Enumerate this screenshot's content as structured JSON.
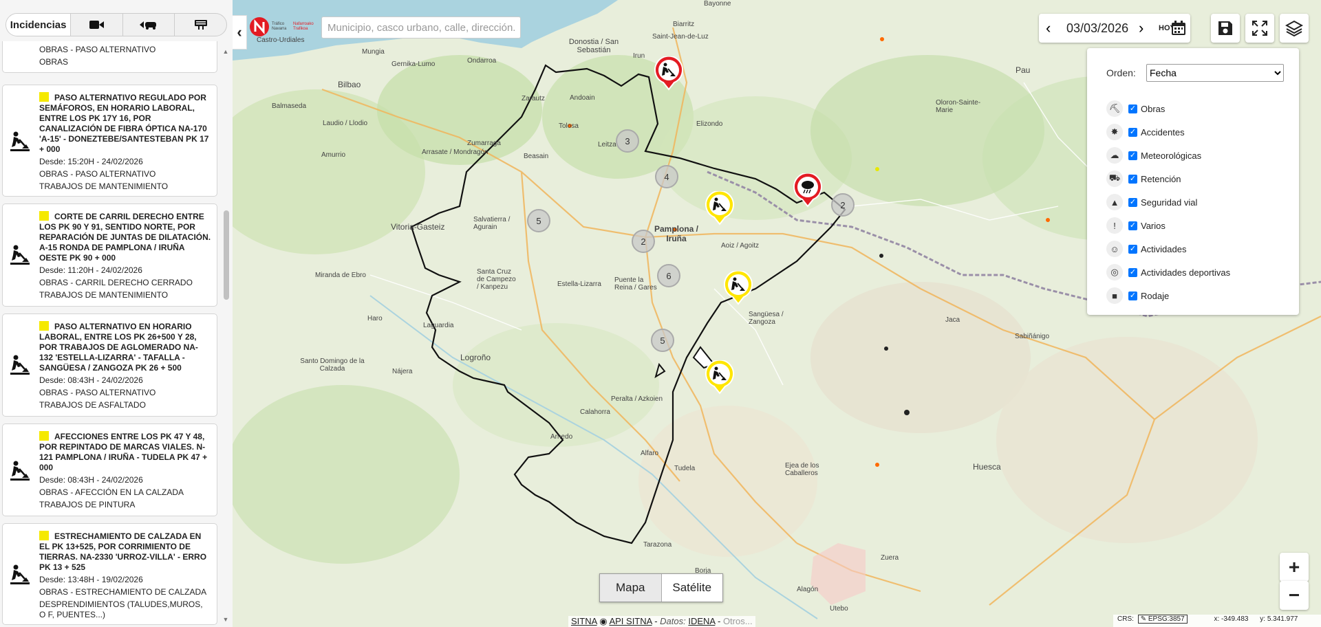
{
  "sidebar": {
    "tabs": [
      {
        "label": "Incidencias",
        "icon": "list-icon"
      },
      {
        "label": "",
        "icon": "camera-icon"
      },
      {
        "label": "",
        "icon": "car-route-icon"
      },
      {
        "label": "",
        "icon": "panel-sign-icon"
      }
    ],
    "top_partial": {
      "line1": "OBRAS - PASO ALTERNATIVO",
      "line2": "OBRAS"
    },
    "incidents": [
      {
        "title": "PASO ALTERNATIVO REGULADO POR SEMÁFOROS, EN HORARIO LABORAL, ENTRE LOS PK 17Y 16, POR CANALIZACIÓN DE FIBRA ÓPTICA NA-170 'A-15' - DONEZTEBE/SANTESTEBAN PK 17 + 000",
        "since": "Desde: 15:20H - 24/02/2026",
        "type": "OBRAS - PASO ALTERNATIVO",
        "subtype": "TRABAJOS DE MANTENIMIENTO"
      },
      {
        "title": "CORTE DE CARRIL DERECHO ENTRE LOS PK 90 Y 91, SENTIDO NORTE, POR REPARACIÓN DE JUNTAS DE DILATACIÓN. A-15 RONDA DE PAMPLONA / IRUÑA OESTE PK 90 + 000",
        "since": "Desde: 11:20H - 24/02/2026",
        "type": "OBRAS - CARRIL DERECHO CERRADO",
        "subtype": "TRABAJOS DE MANTENIMIENTO"
      },
      {
        "title": "PASO ALTERNATIVO EN HORARIO LABORAL, ENTRE LOS PK 26+500 Y 28, POR TRABAJOS DE AGLOMERADO NA-132 'ESTELLA-LIZARRA' - TAFALLA - SANGÜESA / ZANGOZA PK 26 + 500",
        "since": "Desde: 08:43H - 24/02/2026",
        "type": "OBRAS - PASO ALTERNATIVO",
        "subtype": "TRABAJOS DE ASFALTADO"
      },
      {
        "title": "AFECCIONES ENTRE LOS PK 47 Y 48, POR REPINTADO DE MARCAS VIALES. N-121 PAMPLONA / IRUÑA - TUDELA PK 47 + 000",
        "since": "Desde: 08:43H - 24/02/2026",
        "type": "OBRAS - AFECCIÓN EN LA CALZADA",
        "subtype": "TRABAJOS DE PINTURA"
      },
      {
        "title": "ESTRECHAMIENTO DE CALZADA EN EL PK 13+525, POR CORRIMIENTO DE TIERRAS. NA-2330 'URROZ-VILLA' - ERRO PK 13 + 525",
        "since": "Desde: 13:48H - 19/02/2026",
        "type": "OBRAS - ESTRECHAMIENTO DE CALZADA",
        "subtype": "DESPRENDIMIENTOS (TALUDES,MUROS, O F, PUENTES...)"
      }
    ]
  },
  "header": {
    "logo_text_1": "Tráfico Navarra",
    "logo_text_2": "Nafarroako Trafikoa",
    "search_placeholder": "Municipio, casco urbano, calle, dirección.",
    "date": "03/03/2026",
    "today_label": "HOY"
  },
  "legend": {
    "order_label": "Orden:",
    "order_value": "Fecha",
    "layers": [
      {
        "label": "Obras",
        "icon": "roadworks-icon",
        "checked": true
      },
      {
        "label": "Accidentes",
        "icon": "accident-icon",
        "checked": true
      },
      {
        "label": "Meteorológicas",
        "icon": "weather-icon",
        "checked": true
      },
      {
        "label": "Retención",
        "icon": "traffic-jam-icon",
        "checked": true
      },
      {
        "label": "Seguridad vial",
        "icon": "road-safety-icon",
        "checked": true
      },
      {
        "label": "Varios",
        "icon": "warning-icon",
        "checked": true
      },
      {
        "label": "Actividades",
        "icon": "people-icon",
        "checked": true
      },
      {
        "label": "Actividades deportivas",
        "icon": "olympic-rings-icon",
        "checked": true
      },
      {
        "label": "Rodaje",
        "icon": "camera-film-icon",
        "checked": true
      }
    ]
  },
  "map": {
    "basemap_options": [
      "Mapa",
      "Satélite"
    ],
    "selected_basemap": "Mapa",
    "clusters": [
      "3",
      "4",
      "2",
      "5",
      "2",
      "6",
      "5"
    ],
    "places": [
      "Bayonne",
      "Biarritz",
      "Saint-Jean-de-Luz",
      "Donostia / San Sebastián",
      "Irun",
      "Bilbao",
      "Mungia",
      "Gernika-Lumo",
      "Ondarroa",
      "Andoain",
      "Tolosa",
      "Zarautz",
      "Zumarraga",
      "Arrasate / Mondragón",
      "Beasain",
      "Leitza",
      "Elizondo",
      "Vitoria-Gasteiz",
      "Salvatierra / Agurain",
      "Pamplona / Iruña",
      "Aoiz / Agoitz",
      "Estella-Lizarra",
      "Puente la Reina / Gares",
      "Sangüesa / Zangoza",
      "Logroño",
      "Haro",
      "Santo Domingo de la Calzada",
      "Calahorra",
      "Peralta / Azkoien",
      "Tudela",
      "Alfaro",
      "Arnedo",
      "Tarazona",
      "Ejea de los Caballeros",
      "Huesca",
      "Jaca",
      "Pau",
      "Oloron-Sainte-Marie",
      "Sabiñánigo",
      "Zuera",
      "Borja",
      "Utebo",
      "Alagón",
      "Balmaseda",
      "Laudio / Llodio",
      "Amurrio",
      "Miranda de Ebro",
      "Laguardia",
      "Nájera",
      "Santa Cruz de Campezo / Kanpezu",
      "Castro-Urdiales"
    ],
    "attribution": {
      "sitna": "SITNA",
      "api": "API SITNA",
      "datos_label": "Datos:",
      "idena": "IDENA",
      "otros": "Otros..."
    },
    "crs": {
      "label": "CRS:",
      "code": "EPSG:3857",
      "x": "x: -349.483",
      "y": "y: 5.341.977"
    }
  },
  "colors": {
    "accent_yellow": "#f5e900",
    "marker_red": "#e31b23",
    "marker_yellow": "#ffe600",
    "border_black": "#111111",
    "water": "#aad3df"
  }
}
